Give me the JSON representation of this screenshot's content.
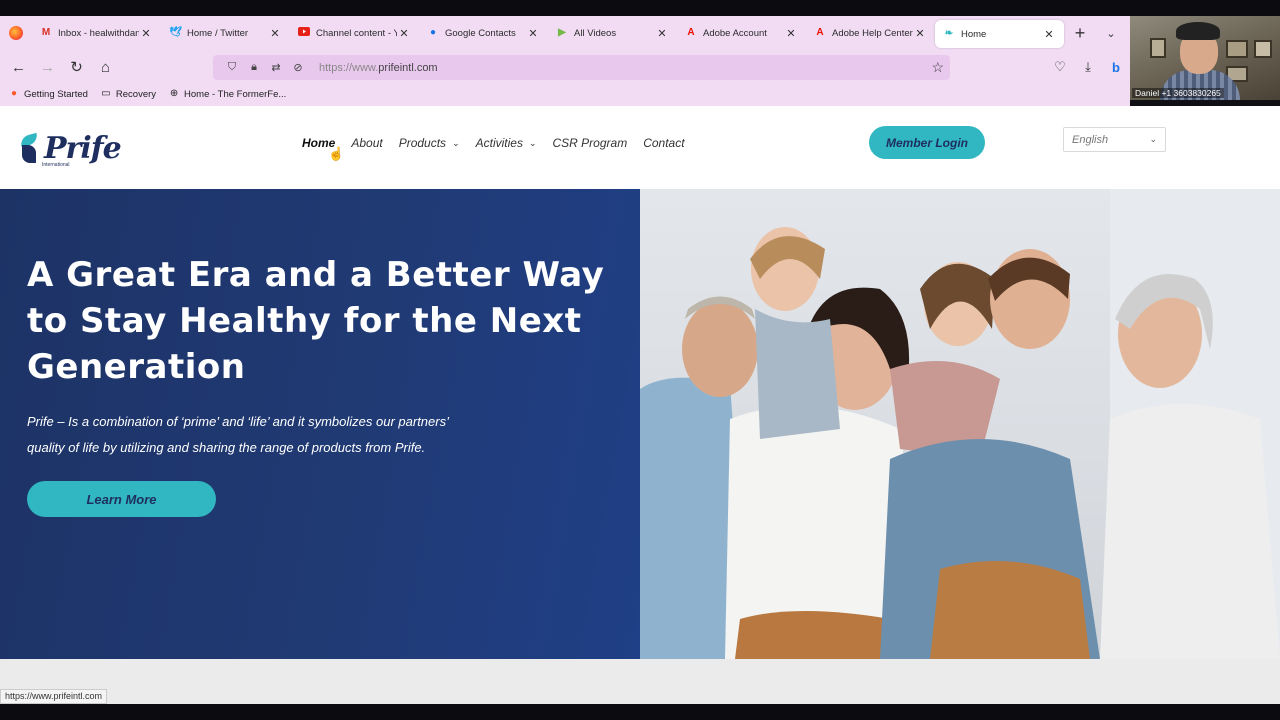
{
  "browser": {
    "tabs": [
      {
        "icon": "gmail-icon",
        "label": "Inbox - healwithdan",
        "active": false
      },
      {
        "icon": "twitter-icon",
        "label": "Home / Twitter",
        "active": false
      },
      {
        "icon": "youtube-icon",
        "label": "Channel content - Yo",
        "active": false
      },
      {
        "icon": "contacts-icon",
        "label": "Google Contacts",
        "active": false
      },
      {
        "icon": "rumble-icon",
        "label": "All Videos",
        "active": false
      },
      {
        "icon": "adobe-icon",
        "label": "Adobe Account",
        "active": false
      },
      {
        "icon": "adobe-icon",
        "label": "Adobe Help Center",
        "active": false
      },
      {
        "icon": "prife-icon",
        "label": "Home",
        "active": true
      }
    ],
    "url_scheme": "https://www.",
    "url_host": "prifeintl.com",
    "bookmarks": [
      {
        "icon": "firefox-icon",
        "label": "Getting Started"
      },
      {
        "icon": "folder-icon",
        "label": "Recovery"
      },
      {
        "icon": "globe-icon",
        "label": "Home - The FormerFe..."
      }
    ],
    "status_url": "https://www.prifeintl.com"
  },
  "webcam": {
    "caption": "Daniel +1 3603830265"
  },
  "site": {
    "logo_text": "Prife",
    "logo_sub": "International",
    "nav": [
      {
        "label": "Home",
        "active": true,
        "dropdown": false
      },
      {
        "label": "About",
        "active": false,
        "dropdown": false
      },
      {
        "label": "Products",
        "active": false,
        "dropdown": true
      },
      {
        "label": "Activities",
        "active": false,
        "dropdown": true
      },
      {
        "label": "CSR Program",
        "active": false,
        "dropdown": false
      },
      {
        "label": "Contact",
        "active": false,
        "dropdown": false
      }
    ],
    "member_login": "Member Login",
    "language": "English",
    "hero_title": "A Great Era and a Better Way to Stay Healthy for the Next Generation",
    "hero_desc": "Prife – Is a combination of ‘prime’ and ‘life’ and it symbolizes our partners’ quality of life by utilizing and sharing the range of products from Prife.",
    "learn_more": "Learn More"
  },
  "colors": {
    "brand_navy": "#1e2e5e",
    "brand_teal": "#31b7c1",
    "hero_blue": "#203a74",
    "browser_chrome": "#f1dcf3"
  }
}
